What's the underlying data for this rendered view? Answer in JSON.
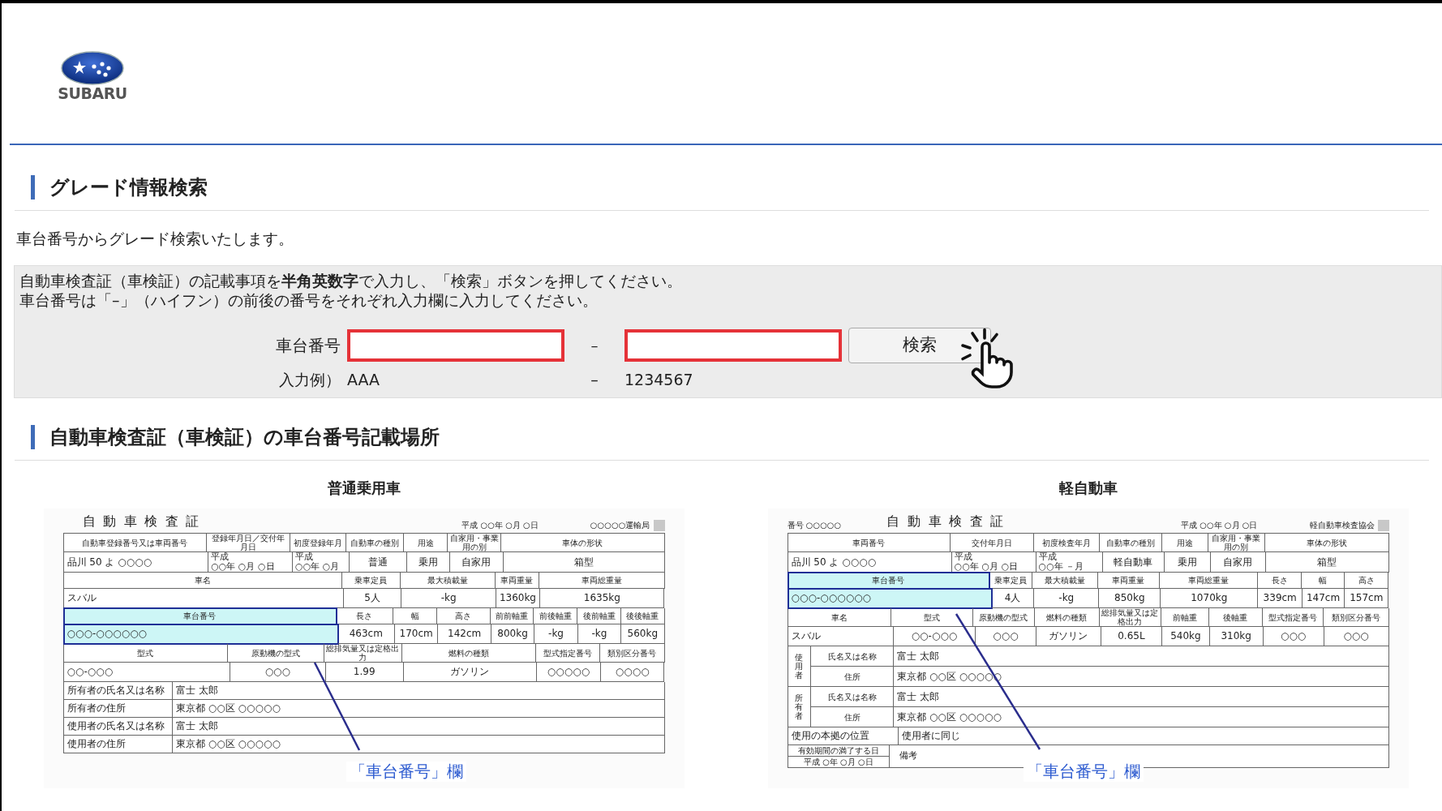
{
  "header": {
    "logo_text": "SUBARU"
  },
  "section_title": "グレード情報検索",
  "intro": "車台番号からグレード検索いたします。",
  "instructions": [
    "自動車検査証（車検証）の記載事項を**半角英数字**で入力し、「検索」ボタンを押してください。",
    "車台番号は「–」（ハイフン）の前後の番号をそれぞれ入力欄に入力してください。"
  ],
  "form": {
    "label": "車台番号",
    "separator": "–",
    "button": "検索",
    "example_label": "入力例）",
    "example_first": "AAA",
    "example_separator": "–",
    "example_second": "1234567"
  },
  "section2_title": "自動車検査証（車検証）の車台番号記載場所",
  "documents": [
    {
      "heading": "普通乗用車",
      "title": "自動車検査証",
      "date": "平成 ○○年 ○月 ○日",
      "issuer": "○○○○○運輸局",
      "callout": "「車台番号」欄",
      "rows": [
        {
          "kind": "header",
          "highlight": false,
          "cells": [
            "自動車登録番号又は車両番号",
            "登録年月日／交付年月日",
            "初度登録年月",
            "自動車の種別",
            "用途",
            "自家用・事業用の別",
            "車体の形状"
          ]
        },
        {
          "kind": "value",
          "highlight": false,
          "cells": [
            "品川 50 よ ○○○○",
            [
              "平成",
              "○○年 ○月 ○日"
            ],
            [
              "平成",
              "○○年 ○月"
            ],
            "普通",
            "乗用",
            "自家用",
            "箱型"
          ]
        },
        {
          "kind": "header",
          "highlight": false,
          "cells": [
            "車名",
            "乗車定員",
            "最大積載量",
            "車両重量",
            "車両総重量"
          ]
        },
        {
          "kind": "value",
          "highlight": false,
          "cells": [
            "スバル",
            "5人",
            "-kg",
            "1360kg",
            "1635kg"
          ]
        },
        {
          "kind": "header",
          "highlight": true,
          "cells": [
            "車台番号",
            "長さ",
            "幅",
            "高さ",
            "前前軸重",
            "前後軸重",
            "後前軸重",
            "後後軸重"
          ]
        },
        {
          "kind": "value",
          "highlight": true,
          "cells": [
            "○○○-○○○○○○",
            "463cm",
            "170cm",
            "142cm",
            "800kg",
            "-kg",
            "-kg",
            "560kg"
          ]
        },
        {
          "kind": "header",
          "highlight": false,
          "cells": [
            "型式",
            "原動機の型式",
            "総排気量又は定格出力",
            "燃料の種類",
            "型式指定番号",
            "類別区分番号"
          ]
        },
        {
          "kind": "value",
          "highlight": false,
          "cells": [
            "○○-○○○",
            "○○○",
            "1.99",
            "ガソリン",
            "○○○○○",
            "○○○○"
          ]
        },
        {
          "kind": "value",
          "highlight": false,
          "cells": [
            "所有者の氏名又は名称",
            "富士 太郎"
          ]
        },
        {
          "kind": "value",
          "highlight": false,
          "cells": [
            "所有者の住所",
            "東京都 ○○区 ○○○○○"
          ]
        },
        {
          "kind": "value",
          "highlight": false,
          "cells": [
            "使用者の氏名又は名称",
            "富士 太郎"
          ]
        },
        {
          "kind": "value",
          "highlight": false,
          "cells": [
            "使用者の住所",
            "東京都 ○○区 ○○○○○"
          ]
        }
      ]
    },
    {
      "heading": "軽自動車",
      "number": "番号 ○○○○○",
      "title": "自動車検査証",
      "date": "平成 ○○年 ○月 ○日",
      "issuer": "軽自動車検査協会",
      "callout": "「車台番号」欄",
      "rows": [
        {
          "kind": "header",
          "highlight": false,
          "cells": [
            "車両番号",
            "交付年月日",
            "初度検査年月",
            "自動車の種別",
            "用途",
            "自家用・事業用の別",
            "車体の形状"
          ]
        },
        {
          "kind": "value",
          "highlight": false,
          "cells": [
            "品川 50 よ ○○○○",
            [
              "平成",
              "○○年 ○月 ○日"
            ],
            [
              "平成",
              "○○年 －月"
            ],
            "軽自動車",
            "乗用",
            "自家用",
            "箱型"
          ]
        },
        {
          "kind": "header",
          "highlight": true,
          "cells": [
            "車台番号",
            "乗車定員",
            "最大積載量",
            "車両重量",
            "車両総重量",
            "長さ",
            "幅",
            "高さ"
          ]
        },
        {
          "kind": "value",
          "highlight": true,
          "cells": [
            "○○○-○○○○○○",
            "4人",
            "-kg",
            "850kg",
            "1070kg",
            "339cm",
            "147cm",
            "157cm"
          ]
        },
        {
          "kind": "header",
          "highlight": false,
          "cells": [
            "車名",
            "型式",
            "原動機の型式",
            "燃料の種類",
            "総排気量又は定格出力",
            "前軸重",
            "後軸重",
            "型式指定番号",
            "類別区分番号"
          ]
        },
        {
          "kind": "value",
          "highlight": false,
          "cells": [
            "スバル",
            "○○-○○○",
            "○○○",
            "ガソリン",
            "0.65L",
            "540kg",
            "310kg",
            "○○○",
            "○○○"
          ]
        },
        {
          "kind": "group",
          "label": "使用者",
          "rows": [
            [
              "氏名又は名称",
              "富士 太郎"
            ],
            [
              "住所",
              "東京都 ○○区 ○○○○○"
            ]
          ]
        },
        {
          "kind": "group",
          "label": "所有者",
          "rows": [
            [
              "氏名又は名称",
              "富士 太郎"
            ],
            [
              "住所",
              "東京都 ○○区 ○○○○○"
            ]
          ]
        },
        {
          "kind": "value",
          "highlight": false,
          "cells": [
            "使用の本拠の位置",
            "使用者に同じ"
          ]
        },
        {
          "kind": "split",
          "left": [
            "有効期間の満了する日",
            "平成 ○年 ○月 ○日"
          ],
          "right": "備考"
        }
      ]
    }
  ]
}
